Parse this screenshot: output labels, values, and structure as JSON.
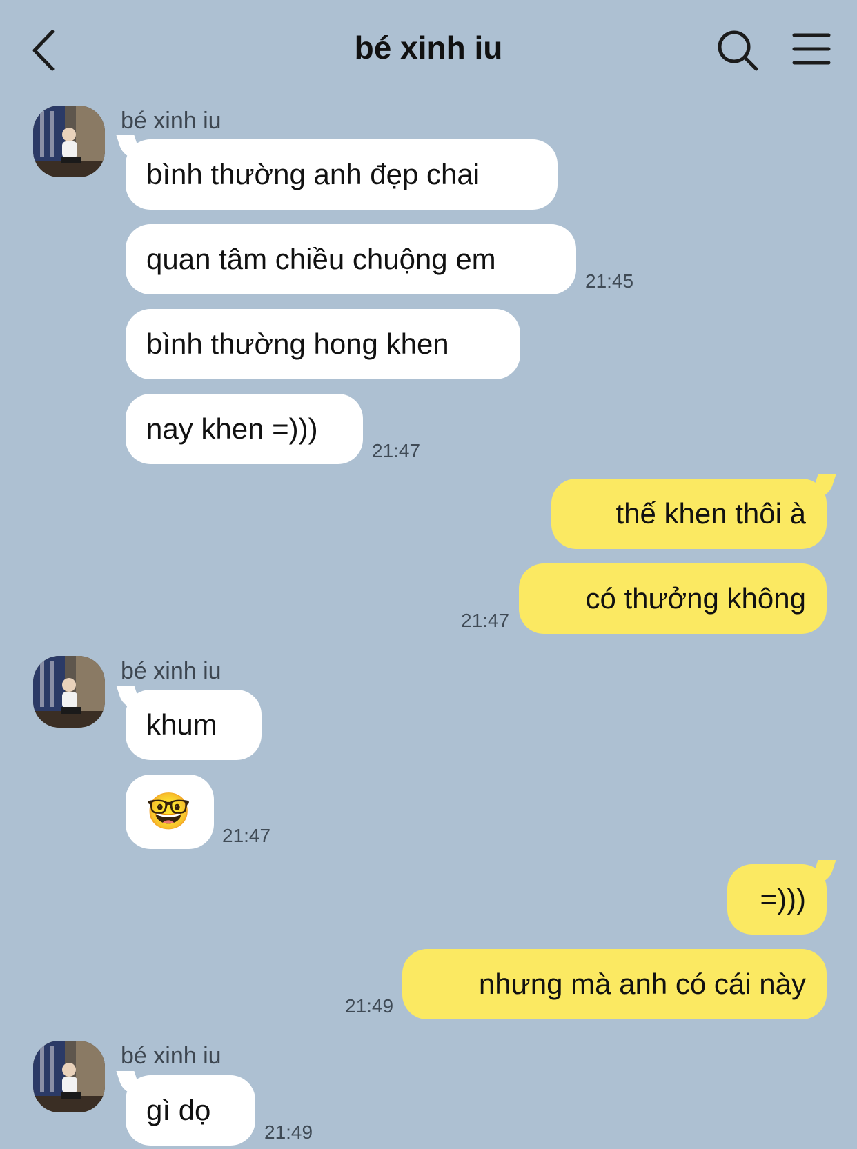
{
  "header": {
    "title": "bé xinh iu"
  },
  "icons": {
    "back": "chevron-left-icon",
    "search": "search-icon",
    "menu": "menu-icon"
  },
  "colors": {
    "background": "#adc0d2",
    "incoming_bubble": "#ffffff",
    "outgoing_bubble": "#fbe962"
  },
  "messages": {
    "g1": {
      "sender": "bé xinh iu",
      "m1": "bình thường anh đẹp chai",
      "m2": "quan tâm chiều chuộng em",
      "time1": "21:45",
      "m3": "bình thường hong khen",
      "m4": "nay khen =)))",
      "time2": "21:47"
    },
    "g2": {
      "m1": "thế khen thôi à",
      "m2": "có thưởng không",
      "time": "21:47"
    },
    "g3": {
      "sender": "bé xinh iu",
      "m1": "khum",
      "emoji": "🤓",
      "time": "21:47"
    },
    "g4": {
      "m1": "=)))",
      "m2": "nhưng mà anh có cái này",
      "time": "21:49"
    },
    "g5": {
      "sender": "bé xinh iu",
      "m1": "gì dọ",
      "time": "21:49"
    }
  }
}
